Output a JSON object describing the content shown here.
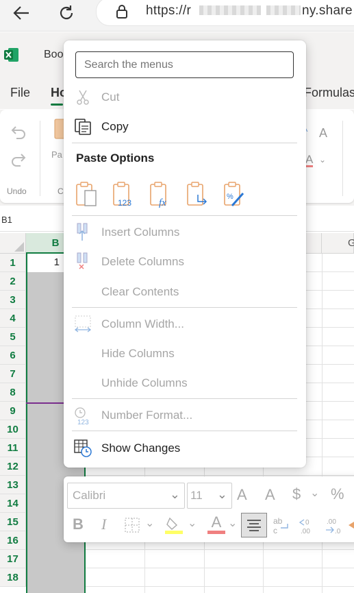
{
  "browser": {
    "url_visible_start": "https://",
    "url_visible_mid": "r",
    "url_visible_end": "ny.share"
  },
  "app": {
    "title_partial": "Boo",
    "tabs": [
      {
        "label": "File"
      },
      {
        "label": "Ho"
      },
      {
        "label": "Formulas"
      }
    ],
    "ribbon": {
      "undo_group_label": "Undo",
      "paste_label_partial": "Pa",
      "clipboard_label_partial": "Cl"
    }
  },
  "formula_bar": {
    "name_box": "B1"
  },
  "grid": {
    "columns": [
      "B",
      "G"
    ],
    "rows": [
      "1",
      "2",
      "3",
      "4",
      "5",
      "6",
      "7",
      "8",
      "9",
      "10",
      "11",
      "12",
      "13",
      "14",
      "15",
      "16",
      "17",
      "18"
    ],
    "b1_value": "1"
  },
  "context_menu": {
    "search_placeholder": "Search the menus",
    "cut": "Cut",
    "copy": "Copy",
    "paste_options_title": "Paste Options",
    "insert_columns": "Insert Columns",
    "delete_columns": "Delete Columns",
    "clear_contents": "Clear Contents",
    "column_width": "Column Width...",
    "hide_columns": "Hide Columns",
    "unhide_columns": "Unhide Columns",
    "number_format": "Number Format...",
    "show_changes": "Show Changes"
  },
  "mini_toolbar": {
    "font": "Calibri",
    "size": "11",
    "bold": "B",
    "italic": "I",
    "font_color_letter": "A",
    "currency": "$",
    "percent": "%",
    "increase_font": "A",
    "decrease_font": "A"
  },
  "colors": {
    "excel_green": "#107c41",
    "disabled_text": "#a6a6a6",
    "paste_icon_orange": "#e8a36b",
    "icon_blue": "#2b78d4"
  }
}
